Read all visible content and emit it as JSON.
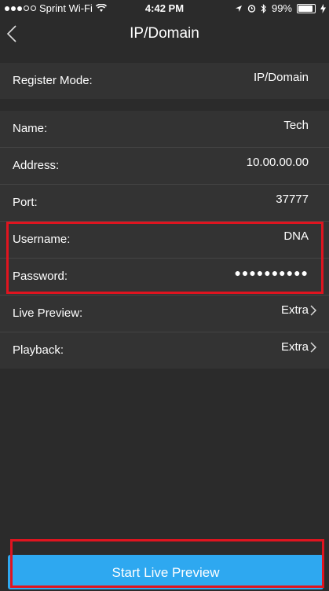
{
  "status_bar": {
    "carrier": "Sprint Wi-Fi",
    "time": "4:42 PM",
    "battery": "99%",
    "battery_level": 0.99,
    "signal_bars_filled": 3,
    "signal_bars_total": 5
  },
  "nav": {
    "title": "IP/Domain",
    "back_icon": "chevron-left-icon"
  },
  "settings": {
    "register_mode": {
      "label": "Register Mode:",
      "value": "IP/Domain"
    },
    "name": {
      "label": "Name:",
      "value": "Tech"
    },
    "address": {
      "label": "Address:",
      "value": "10.00.00.00"
    },
    "port": {
      "label": "Port:",
      "value": "37777"
    },
    "username": {
      "label": "Username:",
      "value": "DNA"
    },
    "password": {
      "label": "Password:",
      "value": "●●●●●●●●●●"
    },
    "live_preview": {
      "label": "Live Preview:",
      "value": "Extra"
    },
    "playback": {
      "label": "Playback:",
      "value": "Extra"
    }
  },
  "actions": {
    "start_live_preview": "Start Live Preview"
  },
  "colors": {
    "background": "#2b2b2b",
    "row_background": "#333333",
    "accent": "#2ea8f0",
    "highlight": "#e0141f"
  }
}
